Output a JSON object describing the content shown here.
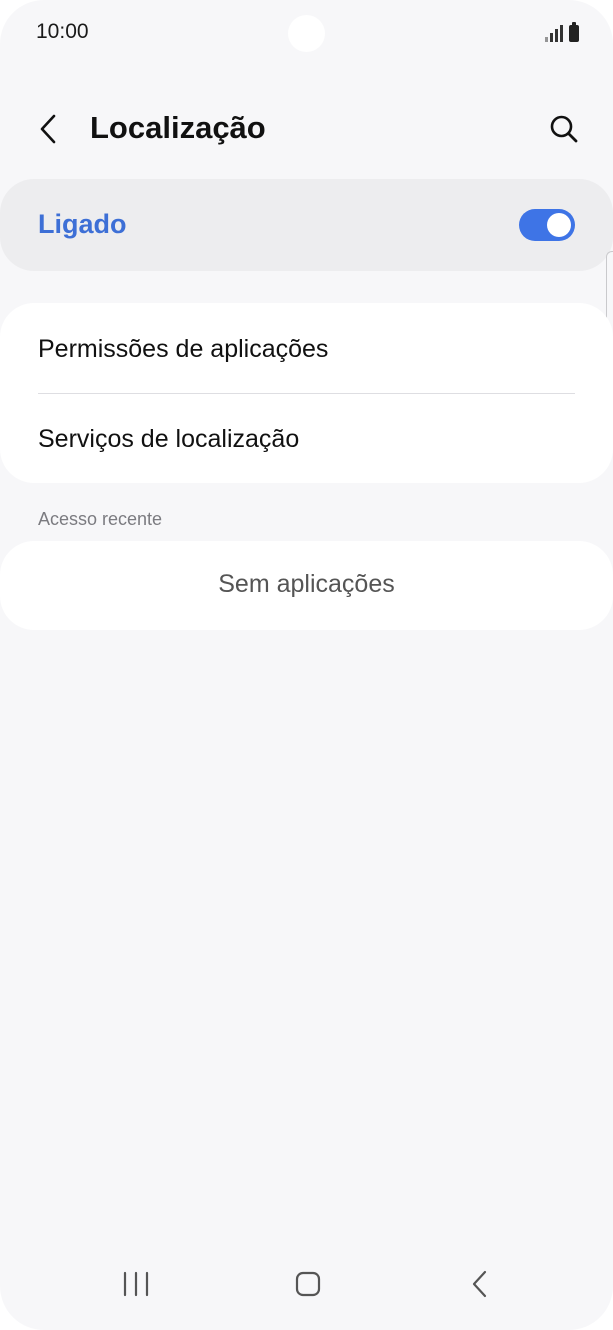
{
  "status_bar": {
    "time": "10:00",
    "icons": [
      "signal-icon",
      "battery-icon"
    ]
  },
  "app_bar": {
    "title": "Localização",
    "back_icon": "chevron-left-icon",
    "search_icon": "search-icon"
  },
  "master_switch": {
    "label": "Ligado",
    "state": "on",
    "accent_color": "#3e74e6"
  },
  "settings": {
    "items": [
      {
        "label": "Permissões de aplicações"
      },
      {
        "label": "Serviços de localização"
      }
    ]
  },
  "recent_access": {
    "header": "Acesso recente",
    "empty_text": "Sem aplicações"
  },
  "nav_bar": {
    "icons": [
      "recents-icon",
      "home-icon",
      "back-icon"
    ]
  }
}
